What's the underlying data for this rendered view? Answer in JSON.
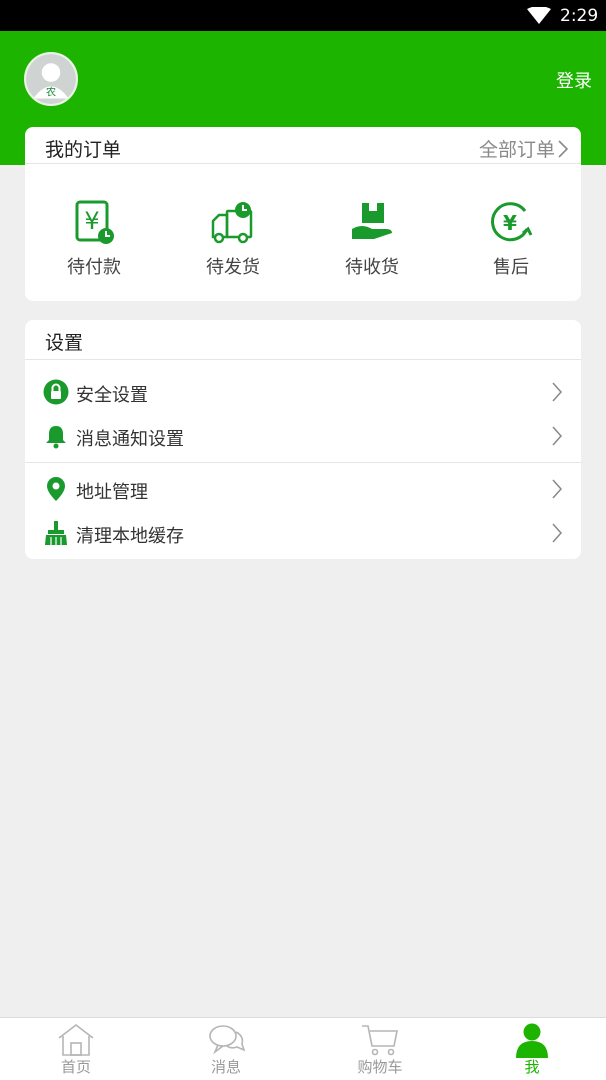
{
  "status_bar": {
    "time": "2:29"
  },
  "header": {
    "login_label": "登录",
    "avatar_text": "农"
  },
  "orders": {
    "title": "我的订单",
    "all_label": "全部订单",
    "items": [
      {
        "label": "待付款",
        "icon": "pending-payment-icon"
      },
      {
        "label": "待发货",
        "icon": "pending-shipment-icon"
      },
      {
        "label": "待收货",
        "icon": "pending-receipt-icon"
      },
      {
        "label": "售后",
        "icon": "after-sales-icon"
      }
    ]
  },
  "settings": {
    "title": "设置",
    "items": [
      {
        "label": "安全设置",
        "icon": "lock-icon"
      },
      {
        "label": "消息通知设置",
        "icon": "bell-icon"
      },
      {
        "label": "地址管理",
        "icon": "location-pin-icon"
      },
      {
        "label": "清理本地缓存",
        "icon": "broom-icon"
      }
    ]
  },
  "tabbar": {
    "tabs": [
      {
        "label": "首页",
        "icon": "home-icon"
      },
      {
        "label": "消息",
        "icon": "chat-icon"
      },
      {
        "label": "购物车",
        "icon": "cart-icon"
      },
      {
        "label": "我",
        "icon": "person-icon",
        "active": true
      }
    ]
  },
  "colors": {
    "brand_green": "#1db400",
    "background": "#efefef",
    "inactive_text": "#999999"
  }
}
